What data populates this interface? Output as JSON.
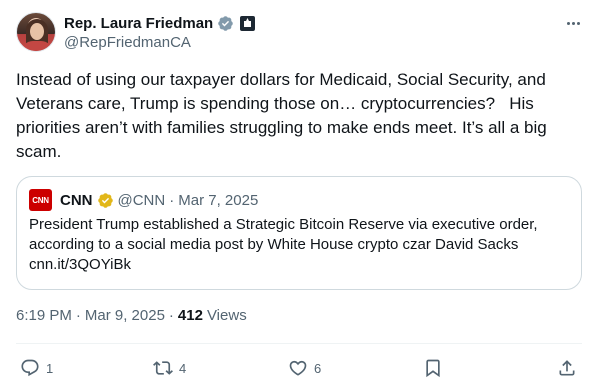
{
  "author": {
    "display_name": "Rep. Laura Friedman",
    "handle": "@RepFriedmanCA"
  },
  "tweet": {
    "text": "Instead of using our taxpayer dollars for Medicaid, Social Security, and Veterans care, Trump is spending those on… cryptocurrencies?   His priorities aren’t with families struggling to make ends meet. It’s all a big scam."
  },
  "quote": {
    "logo_text": "CNN",
    "display_name": "CNN",
    "handle": "@CNN",
    "separator": "·",
    "date": "Mar 7, 2025",
    "text": "President Trump established a Strategic Bitcoin Reserve via executive order, according to a social media post by White House crypto czar David Sacks cnn.it/3QOYiBk"
  },
  "meta": {
    "time": "6:19 PM",
    "separator": "·",
    "date": "Mar 9, 2025",
    "separator2": "·",
    "views_count": "412",
    "views_label": "Views"
  },
  "actions": {
    "reply_count": "1",
    "retweet_count": "4",
    "like_count": "6",
    "bookmark_count": "",
    "share_count": ""
  },
  "colors": {
    "text": "#0f1419",
    "secondary": "#536471",
    "border": "#cfd9de",
    "verified_blue": "#1d9bf0",
    "verified_gold": "#e2b719",
    "cnn_red": "#cc0000"
  },
  "icons": [
    "verified-badge-icon",
    "government-badge-icon",
    "more-icon",
    "cnn-logo",
    "reply-icon",
    "retweet-icon",
    "like-icon",
    "bookmark-icon",
    "share-icon"
  ]
}
